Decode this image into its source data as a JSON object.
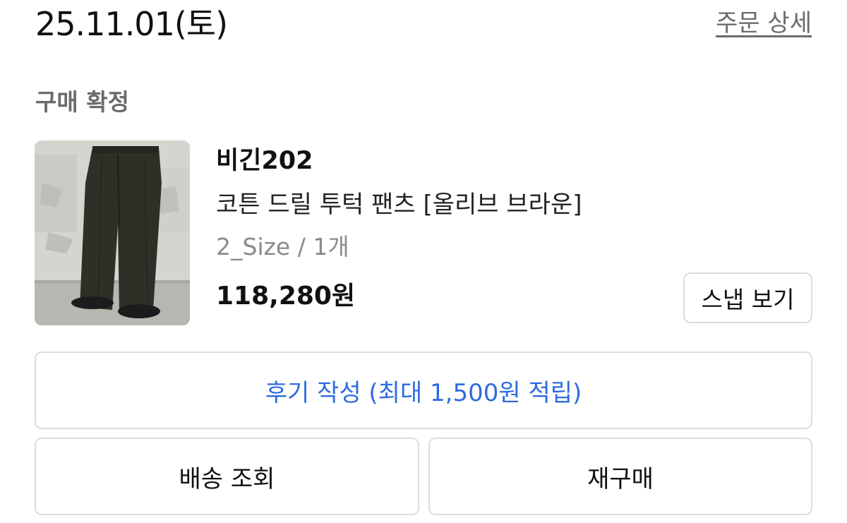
{
  "order": {
    "date": "25.11.01(토)",
    "detail_link": "주문 상세",
    "status": "구매 확정"
  },
  "product": {
    "brand": "비긴202",
    "name": "코튼 드릴 투턱 팬츠 [올리브 브라운]",
    "option": "2_Size / 1개",
    "price": "118,280원",
    "image_icon": "product-photo-wide-pants"
  },
  "actions": {
    "snap_label": "스냅 보기",
    "review_label": "후기 작성 (최대 1,500원 적립)",
    "track_label": "배송 조회",
    "rebuy_label": "재구매"
  },
  "colors": {
    "accent": "#2e6ce0",
    "muted_text": "#6b6b6b",
    "border": "#dcdcdc"
  }
}
